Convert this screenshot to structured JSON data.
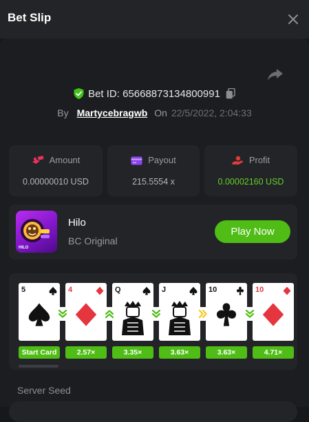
{
  "header": {
    "title": "Bet Slip"
  },
  "bet": {
    "id_label": "Bet ID: 65668873134800991",
    "by_label": "By",
    "username": "Martycebragwb",
    "on_label": "On",
    "date": "22/5/2022, 2:04:33"
  },
  "stats": [
    {
      "label": "Amount",
      "value": "0.00000010 USD",
      "icon": "coin-stack-icon",
      "color": "#e8345b"
    },
    {
      "label": "Payout",
      "value": "215.5554 x",
      "icon": "card-payout-icon",
      "color": "#8b45ec"
    },
    {
      "label": "Profit",
      "value": "0.00002160 USD",
      "icon": "hand-coin-icon",
      "color": "#e03a3a"
    }
  ],
  "game": {
    "name": "Hilo",
    "provider": "BC Original",
    "play_label": "Play Now",
    "thumb_text": "HILO"
  },
  "cards": [
    {
      "rank": "5",
      "suit": "spade",
      "color": "#111",
      "multiplier": "Start Card"
    },
    {
      "rank": "4",
      "suit": "diamond",
      "color": "#e5353f",
      "multiplier": "2.57×"
    },
    {
      "rank": "Q",
      "suit": "spade",
      "color": "#111",
      "multiplier": "3.35×"
    },
    {
      "rank": "J",
      "suit": "spade",
      "color": "#111",
      "multiplier": "3.63×"
    },
    {
      "rank": "10",
      "suit": "club",
      "color": "#111",
      "multiplier": "3.63×"
    },
    {
      "rank": "10",
      "suit": "diamond",
      "color": "#e5353f",
      "multiplier": "4.71×"
    }
  ],
  "guesses": [
    {
      "type": "lower",
      "icon": "double-chevron-down-icon"
    },
    {
      "type": "higher",
      "icon": "double-chevron-up-icon"
    },
    {
      "type": "lower",
      "icon": "double-chevron-down-icon"
    },
    {
      "type": "skip",
      "icon": "double-chevron-right-icon"
    },
    {
      "type": "lower",
      "icon": "double-chevron-down-icon"
    }
  ],
  "seed": {
    "label": "Server Seed"
  },
  "colors": {
    "accent_green": "#4fbd16",
    "profit_green": "#62d12a",
    "skip_yellow": "#f2c81c"
  }
}
